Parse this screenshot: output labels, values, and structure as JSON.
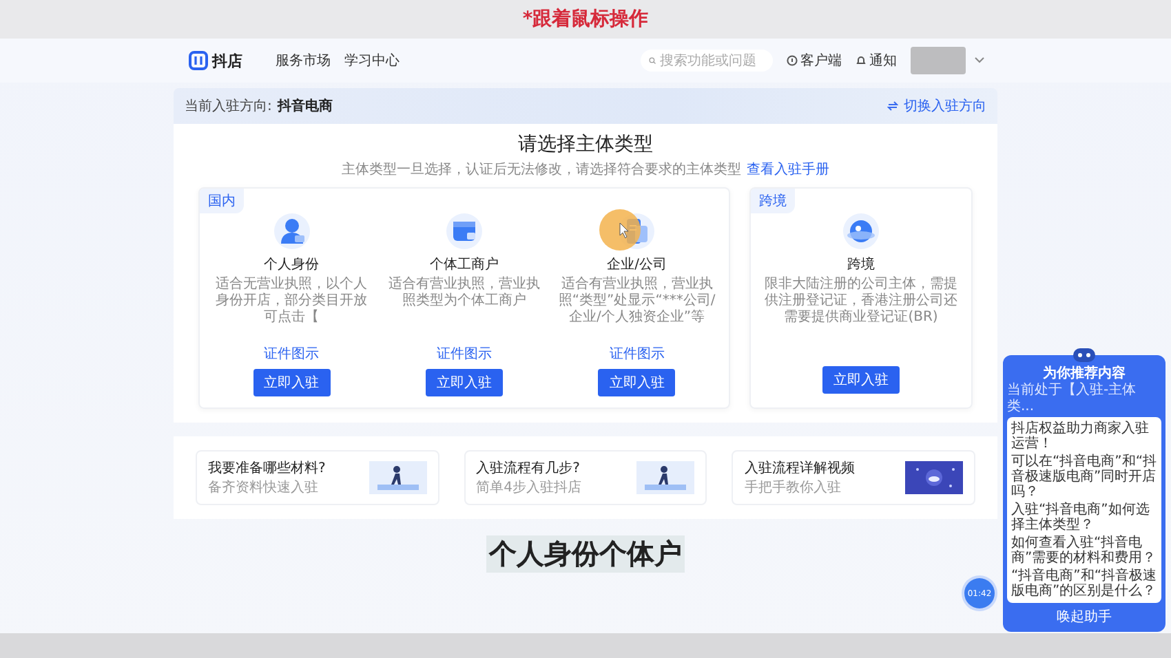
{
  "caption": "*跟着鼠标操作",
  "nav": {
    "logo": "抖店",
    "links": [
      "服务市场",
      "学习中心"
    ],
    "search": {
      "placeholder": "搜索功能或问题"
    },
    "actions": [
      {
        "kind": "client",
        "label": "客户端"
      },
      {
        "kind": "bell",
        "label": "通知"
      }
    ]
  },
  "banner": {
    "label": "当前入驻方向:",
    "value": "抖音电商",
    "switch_link": "切换入驻方向"
  },
  "main": {
    "title": "请选择主体类型",
    "subtitle": "主体类型一旦选择，认证后无法修改，请选择符合要求的主体类型",
    "guide_link": "查看入驻手册",
    "groups": [
      {
        "tag": "国内",
        "options": [
          {
            "kind": "person",
            "name": "个人身份",
            "description": "适合无营业执照，以个人身份开店，部分类目开放可点击【",
            "sample_link": "证件图示",
            "button": "立即入驻",
            "pointer": false
          },
          {
            "kind": "shop",
            "name": "个体工商户",
            "description": "适合有营业执照，营业执照类型为个体工商户",
            "sample_link": "证件图示",
            "button": "立即入驻",
            "pointer": false
          },
          {
            "kind": "company",
            "name": "企业/公司",
            "description": "适合有营业执照，营业执照“类型”处显示“***公司/企业/个人独资企业”等",
            "sample_link": "证件图示",
            "button": "立即入驻",
            "pointer": true
          }
        ]
      },
      {
        "tag": "跨境",
        "options": [
          {
            "kind": "globe",
            "name": "跨境",
            "description": "限非大陆注册的公司主体，需提供注册登记证，香港注册公司还需要提供商业登记证(BR)",
            "button": "立即入驻",
            "pointer": false
          }
        ]
      }
    ]
  },
  "help": [
    {
      "kind": "illustration",
      "title": "我要准备哪些材料?",
      "subtitle": "备齐资料快速入驻"
    },
    {
      "kind": "illustration",
      "title": "入驻流程有几步?",
      "subtitle": "简单4步入驻抖店"
    },
    {
      "kind": "video",
      "title": "入驻流程详解视频",
      "subtitle": "手把手教你入驻"
    }
  ],
  "video_subtitle": "个人身份个体户",
  "timer": "01:42",
  "assistant": {
    "title": "为你推荐内容",
    "context": "当前处于【入驻-主体类...",
    "questions": [
      "抖店权益助力商家入驻运营！",
      "可以在“抖音电商”和“抖音极速版电商”同时开店吗？",
      "入驻“抖音电商”如何选择主体类型？",
      "如何查看入驻“抖音电商”需要的材料和费用？",
      "“抖音电商”和“抖音极速版电商”的区别是什么？"
    ],
    "button": "唤起助手"
  }
}
